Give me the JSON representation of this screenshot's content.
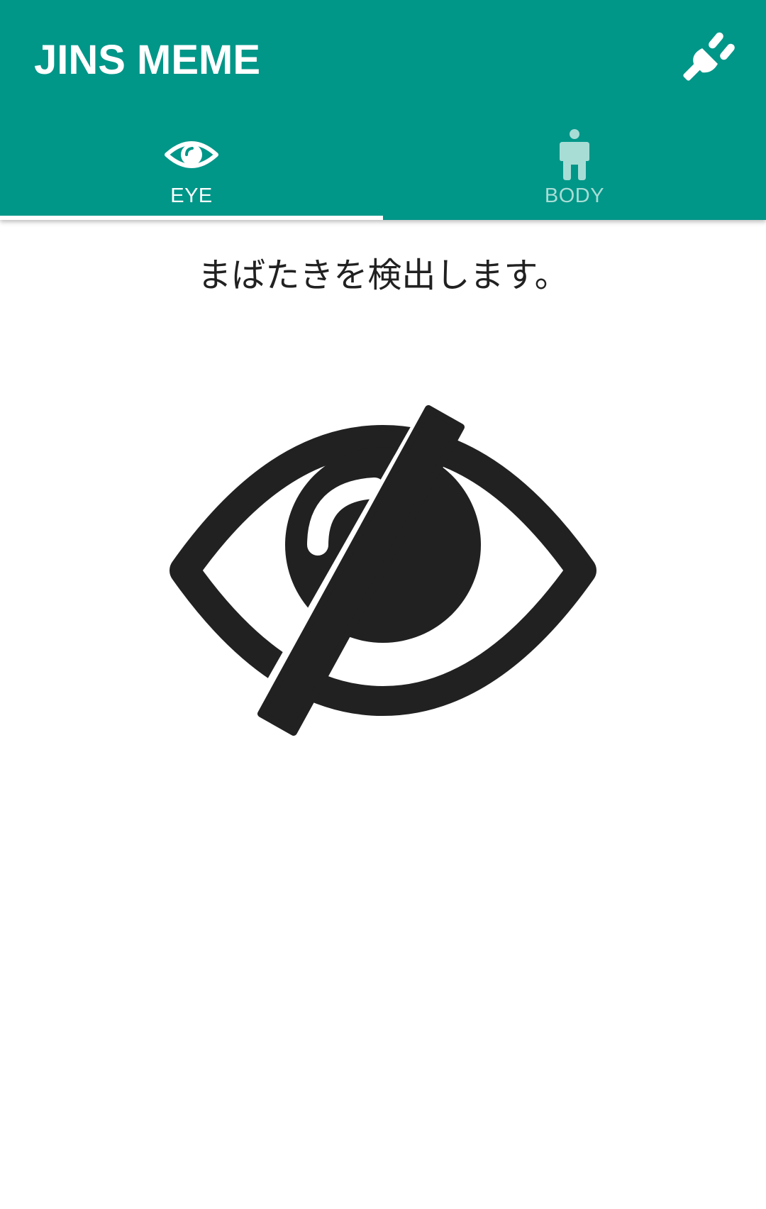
{
  "app_bar": {
    "title": "JINS MEME",
    "connect_icon": "power-plug-icon"
  },
  "tabs": [
    {
      "label": "EYE",
      "icon": "eye-icon",
      "active": true
    },
    {
      "label": "BODY",
      "icon": "person-icon",
      "active": false
    }
  ],
  "main": {
    "message": "まばたきを検出します。",
    "status_icon": "eye-off-icon"
  },
  "colors": {
    "primary": "#009688",
    "tab_active": "#ffffff",
    "tab_inactive": "#a8ddd6",
    "icon_dark": "#212121"
  }
}
